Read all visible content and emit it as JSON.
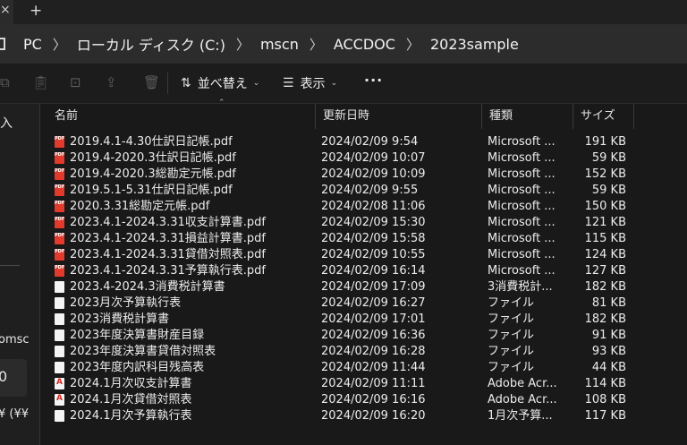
{
  "tabs": {
    "close_glyph": "×",
    "new_tab_glyph": "+"
  },
  "breadcrumb": {
    "items": [
      "PC",
      "ローカル ディスク (C:)",
      "mscn",
      "ACCDOC",
      "2023sample"
    ],
    "separator": "〉"
  },
  "toolbar": {
    "sort_label": "並べ替え",
    "view_label": "表示",
    "more_label": "···",
    "icons": [
      "copy-icon",
      "paste-icon",
      "rename-icon",
      "share-icon",
      "delete-icon",
      "sort-icon",
      "view-icon"
    ]
  },
  "nav": {
    "item1": "入",
    "item2": "omsc",
    "item3": "0",
    "item4": "¥ (¥¥"
  },
  "columns": {
    "name": "名前",
    "modified": "更新日時",
    "type": "種類",
    "size": "サイズ"
  },
  "files": [
    {
      "icon": "pdf",
      "name": "2019.4.1-4.30仕訳日記帳.pdf",
      "modified": "2024/02/09 9:54",
      "type": "Microsoft ...",
      "size": "191 KB"
    },
    {
      "icon": "pdf",
      "name": "2019.4-2020.3仕訳日記帳.pdf",
      "modified": "2024/02/09 10:07",
      "type": "Microsoft ...",
      "size": "59 KB"
    },
    {
      "icon": "pdf",
      "name": "2019.4-2020.3総勘定元帳.pdf",
      "modified": "2024/02/09 10:09",
      "type": "Microsoft ...",
      "size": "152 KB"
    },
    {
      "icon": "pdf",
      "name": "2019.5.1-5.31仕訳日記帳.pdf",
      "modified": "2024/02/09 9:55",
      "type": "Microsoft ...",
      "size": "59 KB"
    },
    {
      "icon": "pdf",
      "name": "2020.3.31総勘定元帳.pdf",
      "modified": "2024/02/08 11:06",
      "type": "Microsoft ...",
      "size": "150 KB"
    },
    {
      "icon": "pdf",
      "name": "2023.4.1-2024.3.31収支計算書.pdf",
      "modified": "2024/02/09 15:30",
      "type": "Microsoft ...",
      "size": "121 KB"
    },
    {
      "icon": "pdf",
      "name": "2023.4.1-2024.3.31損益計算書.pdf",
      "modified": "2024/02/09 15:58",
      "type": "Microsoft ...",
      "size": "115 KB"
    },
    {
      "icon": "pdf",
      "name": "2023.4.1-2024.3.31貸借対照表.pdf",
      "modified": "2024/02/09 10:55",
      "type": "Microsoft ...",
      "size": "124 KB"
    },
    {
      "icon": "pdf",
      "name": "2023.4.1-2024.3.31予算執行表.pdf",
      "modified": "2024/02/09 16:14",
      "type": "Microsoft ...",
      "size": "127 KB"
    },
    {
      "icon": "file",
      "name": "2023.4-2024.3消費税計算書",
      "modified": "2024/02/09 17:09",
      "type": "3消費税計...",
      "size": "182 KB"
    },
    {
      "icon": "file",
      "name": "2023月次予算執行表",
      "modified": "2024/02/09 16:27",
      "type": "ファイル",
      "size": "81 KB"
    },
    {
      "icon": "file",
      "name": "2023消費税計算書",
      "modified": "2024/02/09 17:01",
      "type": "ファイル",
      "size": "182 KB"
    },
    {
      "icon": "file",
      "name": "2023年度決算書財産目録",
      "modified": "2024/02/09 16:36",
      "type": "ファイル",
      "size": "91 KB"
    },
    {
      "icon": "file",
      "name": "2023年度決算書貸借対照表",
      "modified": "2024/02/09 16:28",
      "type": "ファイル",
      "size": "93 KB"
    },
    {
      "icon": "file",
      "name": "2023年度内訳科目残高表",
      "modified": "2024/02/09 11:44",
      "type": "ファイル",
      "size": "44 KB"
    },
    {
      "icon": "acrobat",
      "name": "2024.1月次収支計算書",
      "modified": "2024/02/09 11:11",
      "type": "Adobe Acr...",
      "size": "114 KB"
    },
    {
      "icon": "acrobat",
      "name": "2024.1月次貸借対照表",
      "modified": "2024/02/09 16:16",
      "type": "Adobe Acr...",
      "size": "108 KB"
    },
    {
      "icon": "file",
      "name": "2024.1月次予算執行表",
      "modified": "2024/02/09 16:20",
      "type": "1月次予算...",
      "size": "117 KB"
    }
  ]
}
